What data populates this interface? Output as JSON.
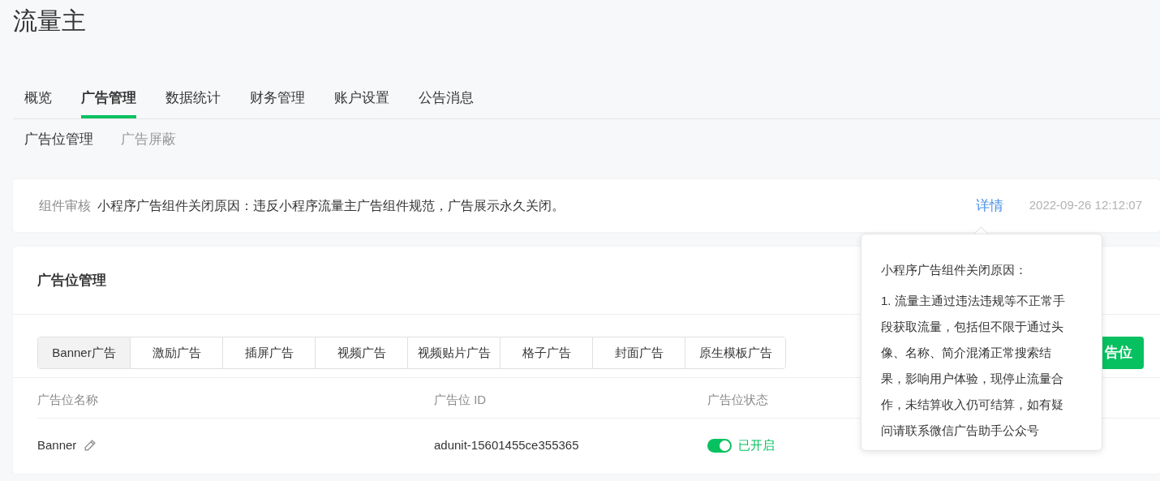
{
  "page_title": "流量主",
  "tabs": [
    {
      "label": "概览",
      "selected": false
    },
    {
      "label": "广告管理",
      "selected": true
    },
    {
      "label": "数据统计",
      "selected": false
    },
    {
      "label": "财务管理",
      "selected": false
    },
    {
      "label": "账户设置",
      "selected": false
    },
    {
      "label": "公告消息",
      "selected": false
    }
  ],
  "subtabs": [
    {
      "label": "广告位管理",
      "selected": true
    },
    {
      "label": "广告屏蔽",
      "selected": false
    }
  ],
  "notice": {
    "tag": "组件审核",
    "message": "小程序广告组件关闭原因：违反小程序流量主广告组件规范，广告展示永久关闭。",
    "link": "详情",
    "time": "2022-09-26 12:12:07"
  },
  "panel": {
    "title": "广告位管理",
    "ad_types": [
      {
        "label": "Banner广告",
        "selected": true
      },
      {
        "label": "激励广告",
        "selected": false
      },
      {
        "label": "插屏广告",
        "selected": false
      },
      {
        "label": "视频广告",
        "selected": false
      },
      {
        "label": "视频贴片广告",
        "selected": false
      },
      {
        "label": "格子广告",
        "selected": false
      },
      {
        "label": "封面广告",
        "selected": false
      },
      {
        "label": "原生模板广告",
        "selected": false
      }
    ],
    "create_button": "告位",
    "columns": [
      "广告位名称",
      "广告位 ID",
      "广告位状态"
    ],
    "rows": [
      {
        "name": "Banner",
        "id": "adunit-15601455ce355365",
        "status": "已开启",
        "on": true
      }
    ]
  },
  "popover": {
    "title": "小程序广告组件关闭原因：",
    "body": "1. 流量主通过违法违规等不正常手段获取流量，包括但不限于通过头像、名称、简介混淆正常搜索结果，影响用户体验，现停止流量合作，未结算收入仍可结算，如有疑问请联系微信广告助手公众号"
  }
}
